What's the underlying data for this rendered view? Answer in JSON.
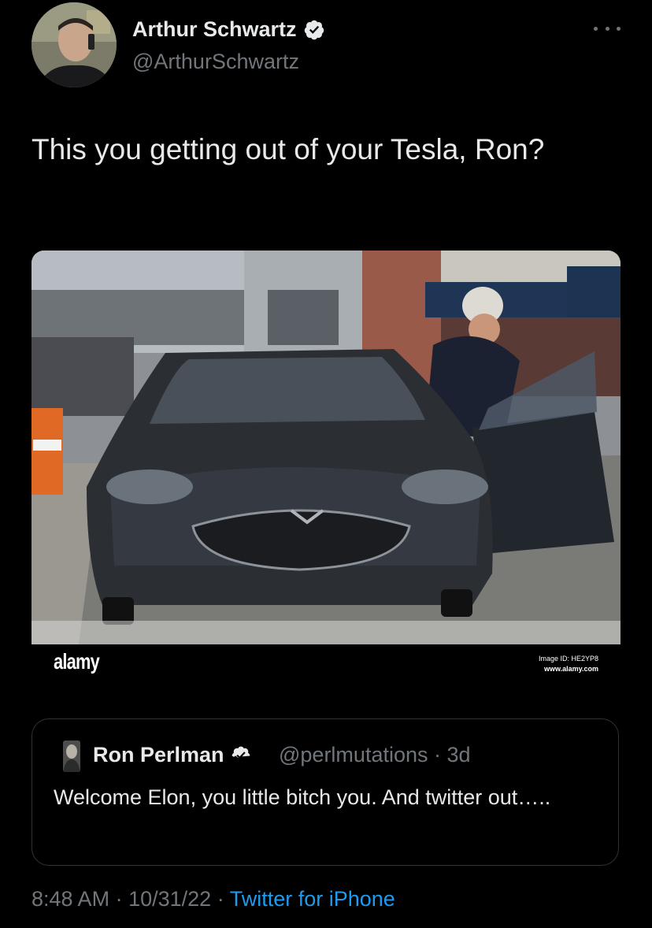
{
  "tweet": {
    "author_name": "Arthur Schwartz",
    "author_handle": "@ArthurSchwartz",
    "text": "This you getting out of your Tesla, Ron?",
    "time": "8:48 AM",
    "separator": "·",
    "date": "10/31/22",
    "source": "Twitter for iPhone"
  },
  "media": {
    "watermark_logo": "alamy",
    "image_id": "Image ID: HE2YP8",
    "url": "www.alamy.com"
  },
  "quote": {
    "author_name": "Ron Perlman",
    "author_handle": "@perlmutations",
    "age": "3d",
    "text": "Welcome Elon, you little bitch you. And twitter out….."
  },
  "icons": {
    "verified": "verified-badge-icon",
    "more": "more-options-icon"
  },
  "colors": {
    "background": "#000000",
    "text_primary": "#e7e9ea",
    "text_secondary": "#71767b",
    "link": "#1d9bf0",
    "border": "#2f3336"
  }
}
